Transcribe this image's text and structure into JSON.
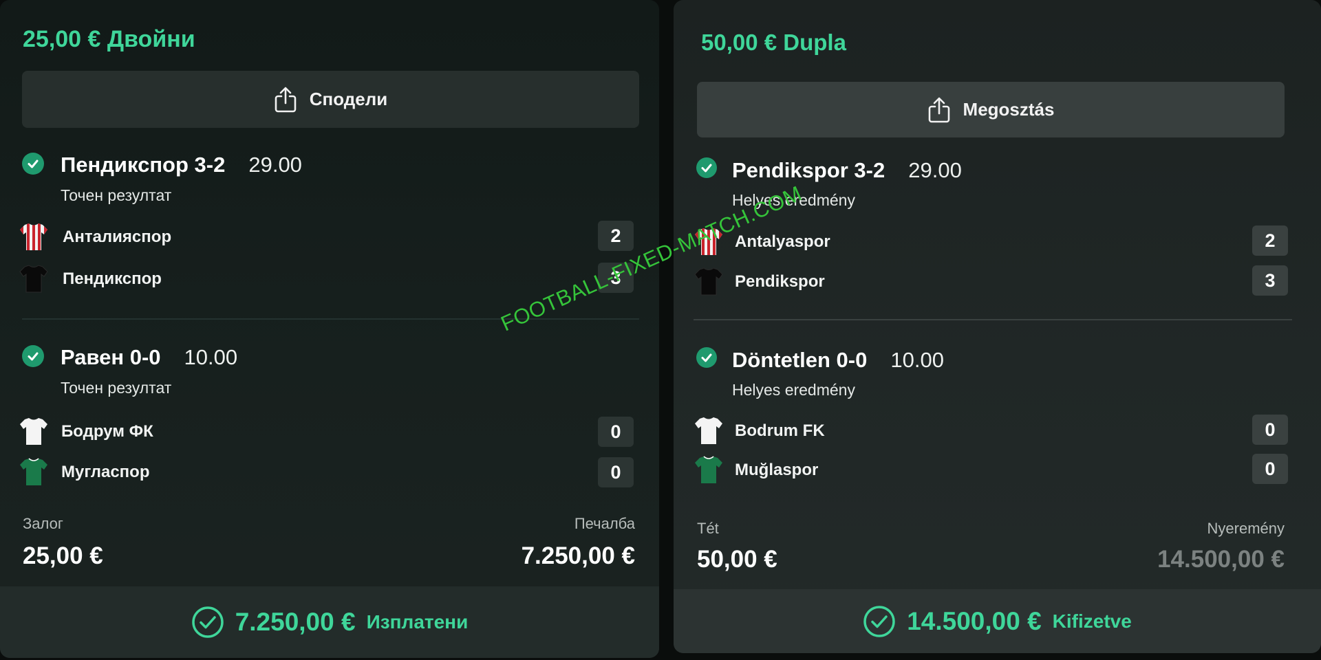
{
  "colors": {
    "accent": "#3fd69a",
    "check": "#1f9a6e",
    "win_greyed": "#7c8281"
  },
  "left": {
    "title": "25,00 € Двойни",
    "share_label": "Сподели",
    "selections": [
      {
        "name": "Пендикспор 3-2",
        "odds": "29.00",
        "market": "Точен резултат",
        "teams": [
          {
            "name": "Анталияспор",
            "score": "2",
            "jersey": "red-white-striped-jersey-icon"
          },
          {
            "name": "Пендикспор",
            "score": "3",
            "jersey": "black-jersey-icon"
          }
        ]
      },
      {
        "name": "Равен 0-0",
        "odds": "10.00",
        "market": "Точен резултат",
        "teams": [
          {
            "name": "Бодрум ФК",
            "score": "0",
            "jersey": "white-jersey-icon"
          },
          {
            "name": "Мугласпор",
            "score": "0",
            "jersey": "green-jersey-icon"
          }
        ]
      }
    ],
    "stake_label": "Залог",
    "stake_value": "25,00 €",
    "win_label": "Печалба",
    "win_value": "7.250,00 €",
    "paid_amount": "7.250,00 €",
    "paid_label": "Изплатени"
  },
  "right": {
    "title": "50,00 € Dupla",
    "share_label": "Megosztás",
    "selections": [
      {
        "name": "Pendikspor 3-2",
        "odds": "29.00",
        "market": "Helyes eredmény",
        "teams": [
          {
            "name": "Antalyaspor",
            "score": "2",
            "jersey": "red-white-striped-jersey-icon"
          },
          {
            "name": "Pendikspor",
            "score": "3",
            "jersey": "black-jersey-icon"
          }
        ]
      },
      {
        "name": "Döntetlen 0-0",
        "odds": "10.00",
        "market": "Helyes eredmény",
        "teams": [
          {
            "name": "Bodrum FK",
            "score": "0",
            "jersey": "white-jersey-icon"
          },
          {
            "name": "Muğlaspor",
            "score": "0",
            "jersey": "green-jersey-icon"
          }
        ]
      }
    ],
    "stake_label": "Tét",
    "stake_value": "50,00 €",
    "win_label": "Nyeremény",
    "win_value": "14.500,00 €",
    "paid_amount": "14.500,00 €",
    "paid_label": "Kifizetve"
  },
  "watermark": "FOOTBALL-FIXED-MATCH.COM"
}
